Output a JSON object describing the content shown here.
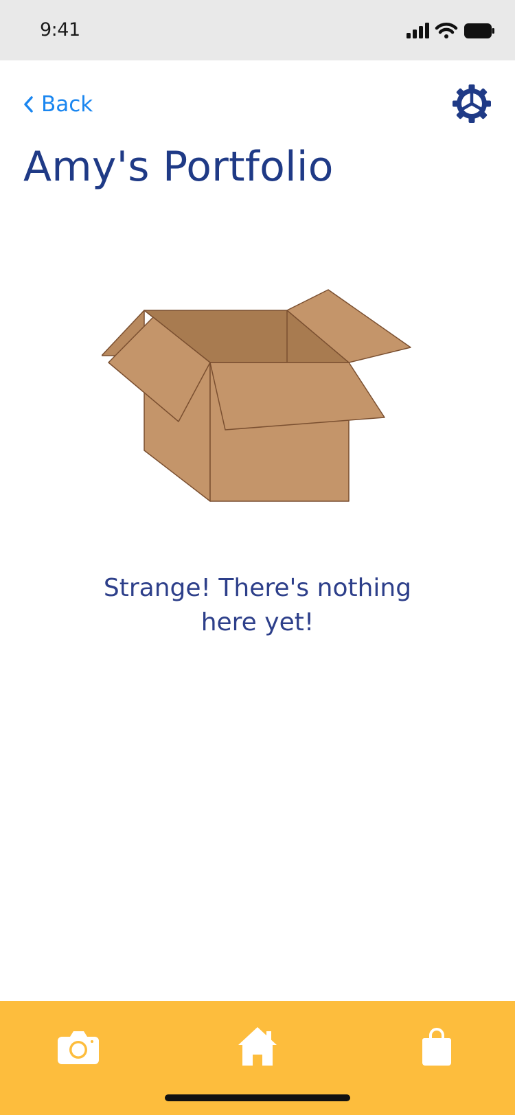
{
  "status_bar": {
    "time": "9:41",
    "icons": [
      "signal-bars-icon",
      "wifi-icon",
      "battery-icon"
    ]
  },
  "header": {
    "back_label": "Back",
    "title": "Amy's Portfolio",
    "settings_icon": "gear-icon"
  },
  "empty_state": {
    "illustration": "open-box-icon",
    "message_line1": "Strange! There's nothing",
    "message_line2": "here yet!"
  },
  "tab_bar": {
    "tabs": [
      {
        "icon": "camera-icon"
      },
      {
        "icon": "home-icon"
      },
      {
        "icon": "shopping-bag-icon"
      }
    ]
  },
  "colors": {
    "accent_blue": "#1a86f0",
    "title_navy": "#1f3a86",
    "tab_bar_yellow": "#fdbd3d",
    "box_brown": "#c4956a"
  }
}
